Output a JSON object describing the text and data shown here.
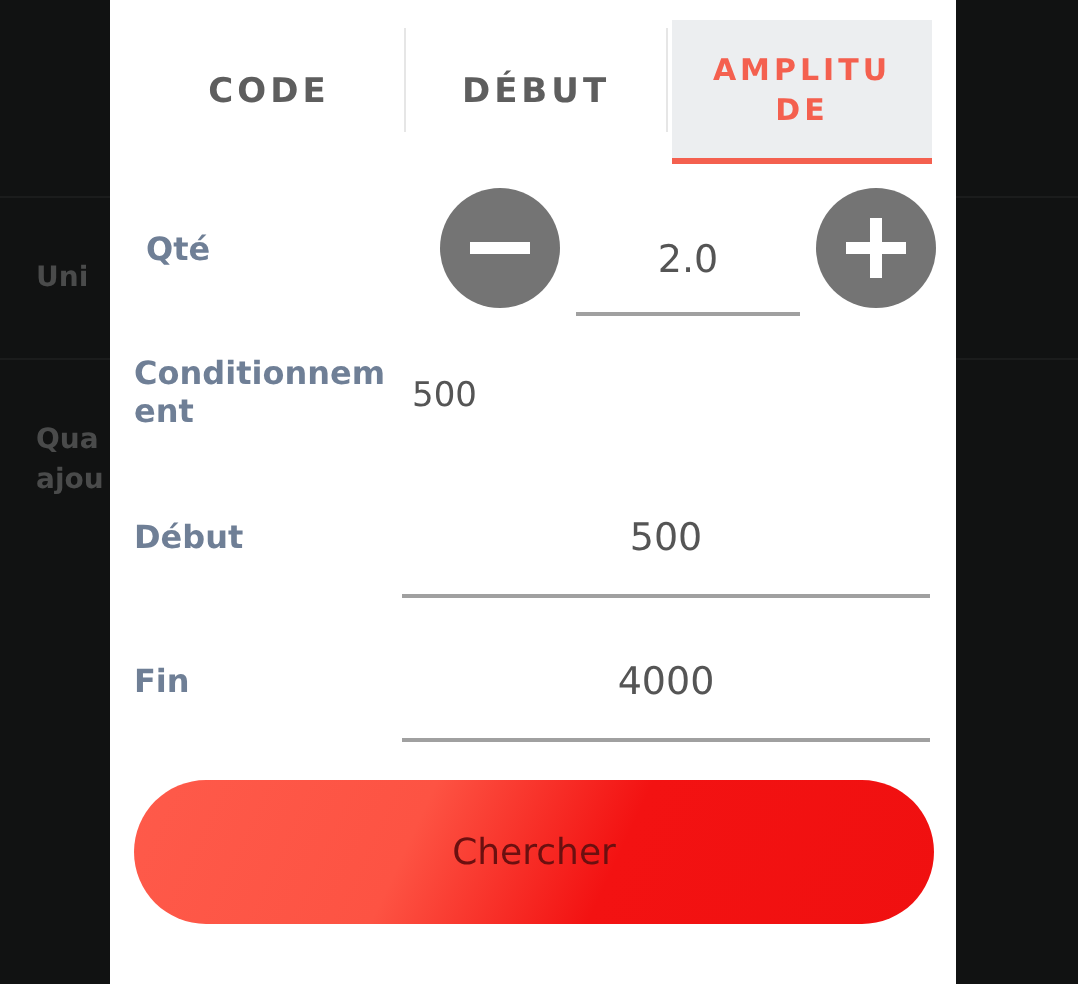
{
  "background": {
    "rows": [
      {
        "lines": [
          "Uni"
        ]
      },
      {
        "lines": [
          "Qua",
          "ajou"
        ]
      }
    ]
  },
  "tabs": [
    {
      "label": "CODE",
      "selected": false
    },
    {
      "label": "DÉBUT",
      "selected": false
    },
    {
      "label": "AMPLITUDE",
      "selected": true
    }
  ],
  "fields": [
    {
      "kind": "stepper",
      "label": "Qté",
      "value": "2.0"
    },
    {
      "kind": "static",
      "label": "Conditionnement",
      "value": "500"
    },
    {
      "kind": "input",
      "label": "Début",
      "value": "500"
    },
    {
      "kind": "input",
      "label": "Fin",
      "value": "4000"
    }
  ],
  "submit_button": "Chercher"
}
